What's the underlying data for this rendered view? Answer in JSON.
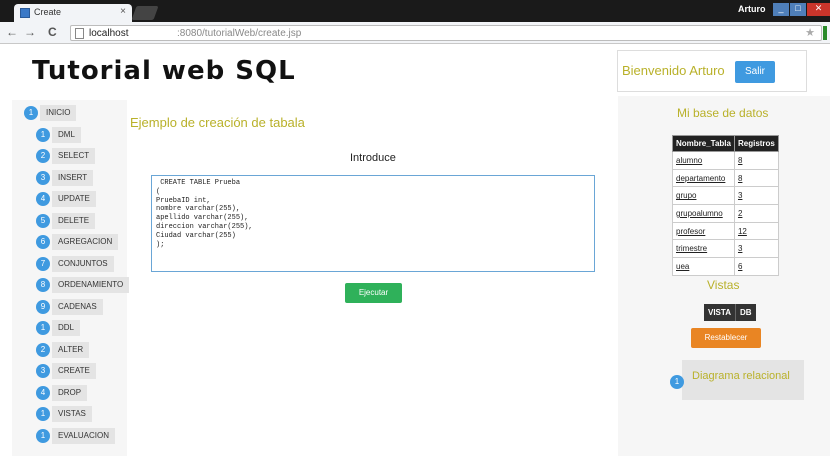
{
  "browser": {
    "tab_title": "Create",
    "tab_close": "×",
    "user": "Arturo",
    "url_host": "localhost",
    "url_rest": ":8080/tutorialWeb/create.jsp",
    "back": "←",
    "forward": "→",
    "reload": "C",
    "star": "★",
    "window_min": "_",
    "window_max": "□",
    "window_close": "✕"
  },
  "header": {
    "site_title": "Tutorial web SQL",
    "welcome": "Bienvenido Arturo",
    "logout_label": "Salir"
  },
  "sidebar": {
    "items": [
      {
        "num": "1",
        "label": "INICIO"
      },
      {
        "num": "1",
        "label": "DML"
      },
      {
        "num": "2",
        "label": "SELECT"
      },
      {
        "num": "3",
        "label": "INSERT"
      },
      {
        "num": "4",
        "label": "UPDATE"
      },
      {
        "num": "5",
        "label": "DELETE"
      },
      {
        "num": "6",
        "label": "AGREGACION"
      },
      {
        "num": "7",
        "label": "CONJUNTOS"
      },
      {
        "num": "8",
        "label": "ORDENAMIENTO"
      },
      {
        "num": "9",
        "label": "CADENAS"
      },
      {
        "num": "1",
        "label": "DDL"
      },
      {
        "num": "2",
        "label": "ALTER"
      },
      {
        "num": "3",
        "label": "CREATE"
      },
      {
        "num": "4",
        "label": "DROP"
      },
      {
        "num": "1",
        "label": "VISTAS"
      },
      {
        "num": "1",
        "label": "EVALUACION"
      }
    ]
  },
  "main": {
    "heading": "Ejemplo de creación de tabala",
    "introduce_label": "Introduce",
    "sql_text": " CREATE TABLE Prueba\n(\nPruebaID int,\nnombre varchar(255),\napellido varchar(255),\ndireccion varchar(255),\nCiudad varchar(255)\n);",
    "run_label": "Ejecutar"
  },
  "right": {
    "db_title": "Mi base de datos",
    "table_headers": [
      "Nombre_Tabla",
      "Registros"
    ],
    "tables": [
      {
        "name": "alumno",
        "count": "8"
      },
      {
        "name": "departamento",
        "count": "8"
      },
      {
        "name": "grupo",
        "count": "3"
      },
      {
        "name": "grupoalumno",
        "count": "2"
      },
      {
        "name": "profesor",
        "count": "12"
      },
      {
        "name": "trimestre",
        "count": "3"
      },
      {
        "name": "uea",
        "count": "6"
      }
    ],
    "views_title": "Vistas",
    "view_btn_part1": "VISTA",
    "view_btn_part2": "DB",
    "reset_label": "Restablecer",
    "diagram_num": "1",
    "diagram_label": "Diagrama relacional"
  },
  "colors": {
    "accent_olive": "#b9b12a",
    "blue": "#3f9ae0",
    "green": "#2fb15a",
    "orange": "#e98523"
  }
}
